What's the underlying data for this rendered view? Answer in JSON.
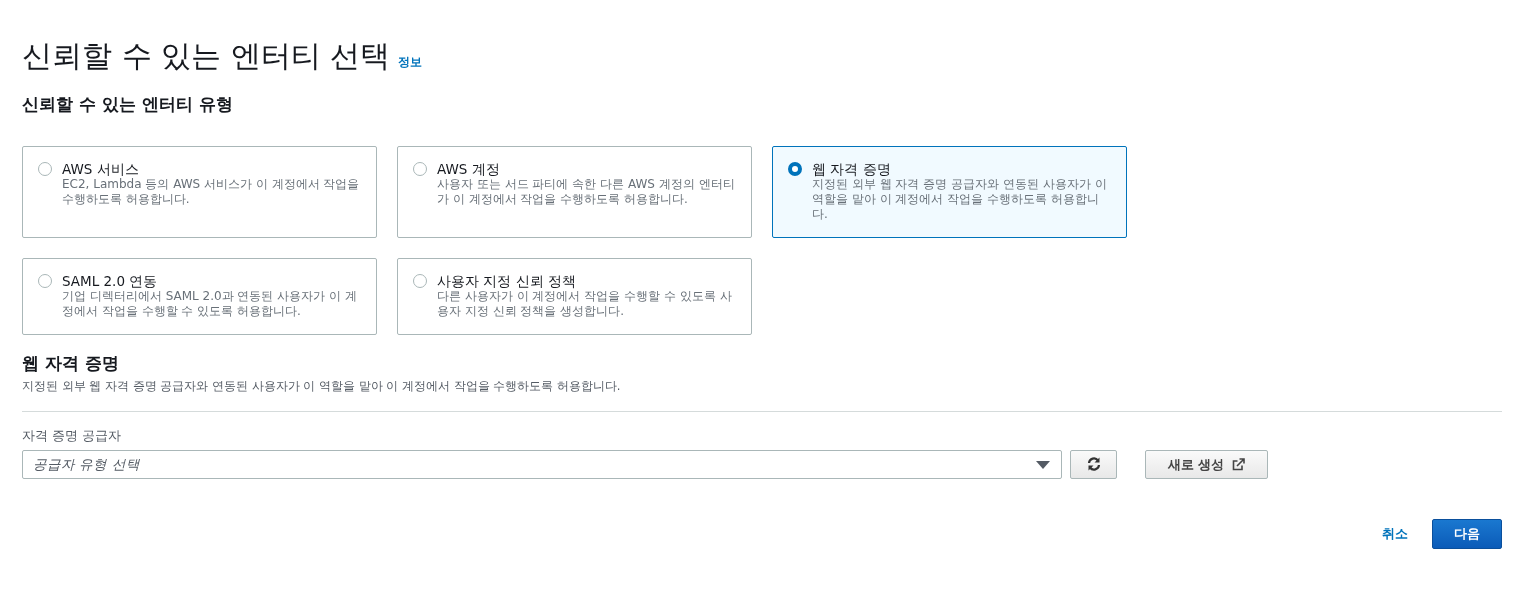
{
  "page": {
    "title": "신뢰할 수 있는 엔터티 선택",
    "info_link": "정보"
  },
  "entity_type": {
    "heading": "신뢰할 수 있는 엔터티 유형",
    "options": [
      {
        "label": "AWS 서비스",
        "description": "EC2, Lambda 등의 AWS 서비스가 이 계정에서 작업을 수행하도록 허용합니다.",
        "selected": false
      },
      {
        "label": "AWS 계정",
        "description": "사용자 또는 서드 파티에 속한 다른 AWS 계정의 엔터티가 이 계정에서 작업을 수행하도록 허용합니다.",
        "selected": false
      },
      {
        "label": "웹 자격 증명",
        "description": "지정된 외부 웹 자격 증명 공급자와 연동된 사용자가 이 역할을 맡아 이 계정에서 작업을 수행하도록 허용합니다.",
        "selected": true
      },
      {
        "label": "SAML 2.0 연동",
        "description": "기업 디렉터리에서 SAML 2.0과 연동된 사용자가 이 계정에서 작업을 수행할 수 있도록 허용합니다.",
        "selected": false
      },
      {
        "label": "사용자 지정 신뢰 정책",
        "description": "다른 사용자가 이 계정에서 작업을 수행할 수 있도록 사용자 지정 신뢰 정책을 생성합니다.",
        "selected": false
      }
    ]
  },
  "web_identity": {
    "heading": "웹 자격 증명",
    "description": "지정된 외부 웹 자격 증명 공급자와 연동된 사용자가 이 역할을 맡아 이 계정에서 작업을 수행하도록 허용합니다.",
    "provider_label": "자격 증명 공급자",
    "provider_select": {
      "placeholder": "공급자 유형 선택"
    },
    "create_button": "새로 생성"
  },
  "footer": {
    "cancel": "취소",
    "next": "다음"
  }
}
